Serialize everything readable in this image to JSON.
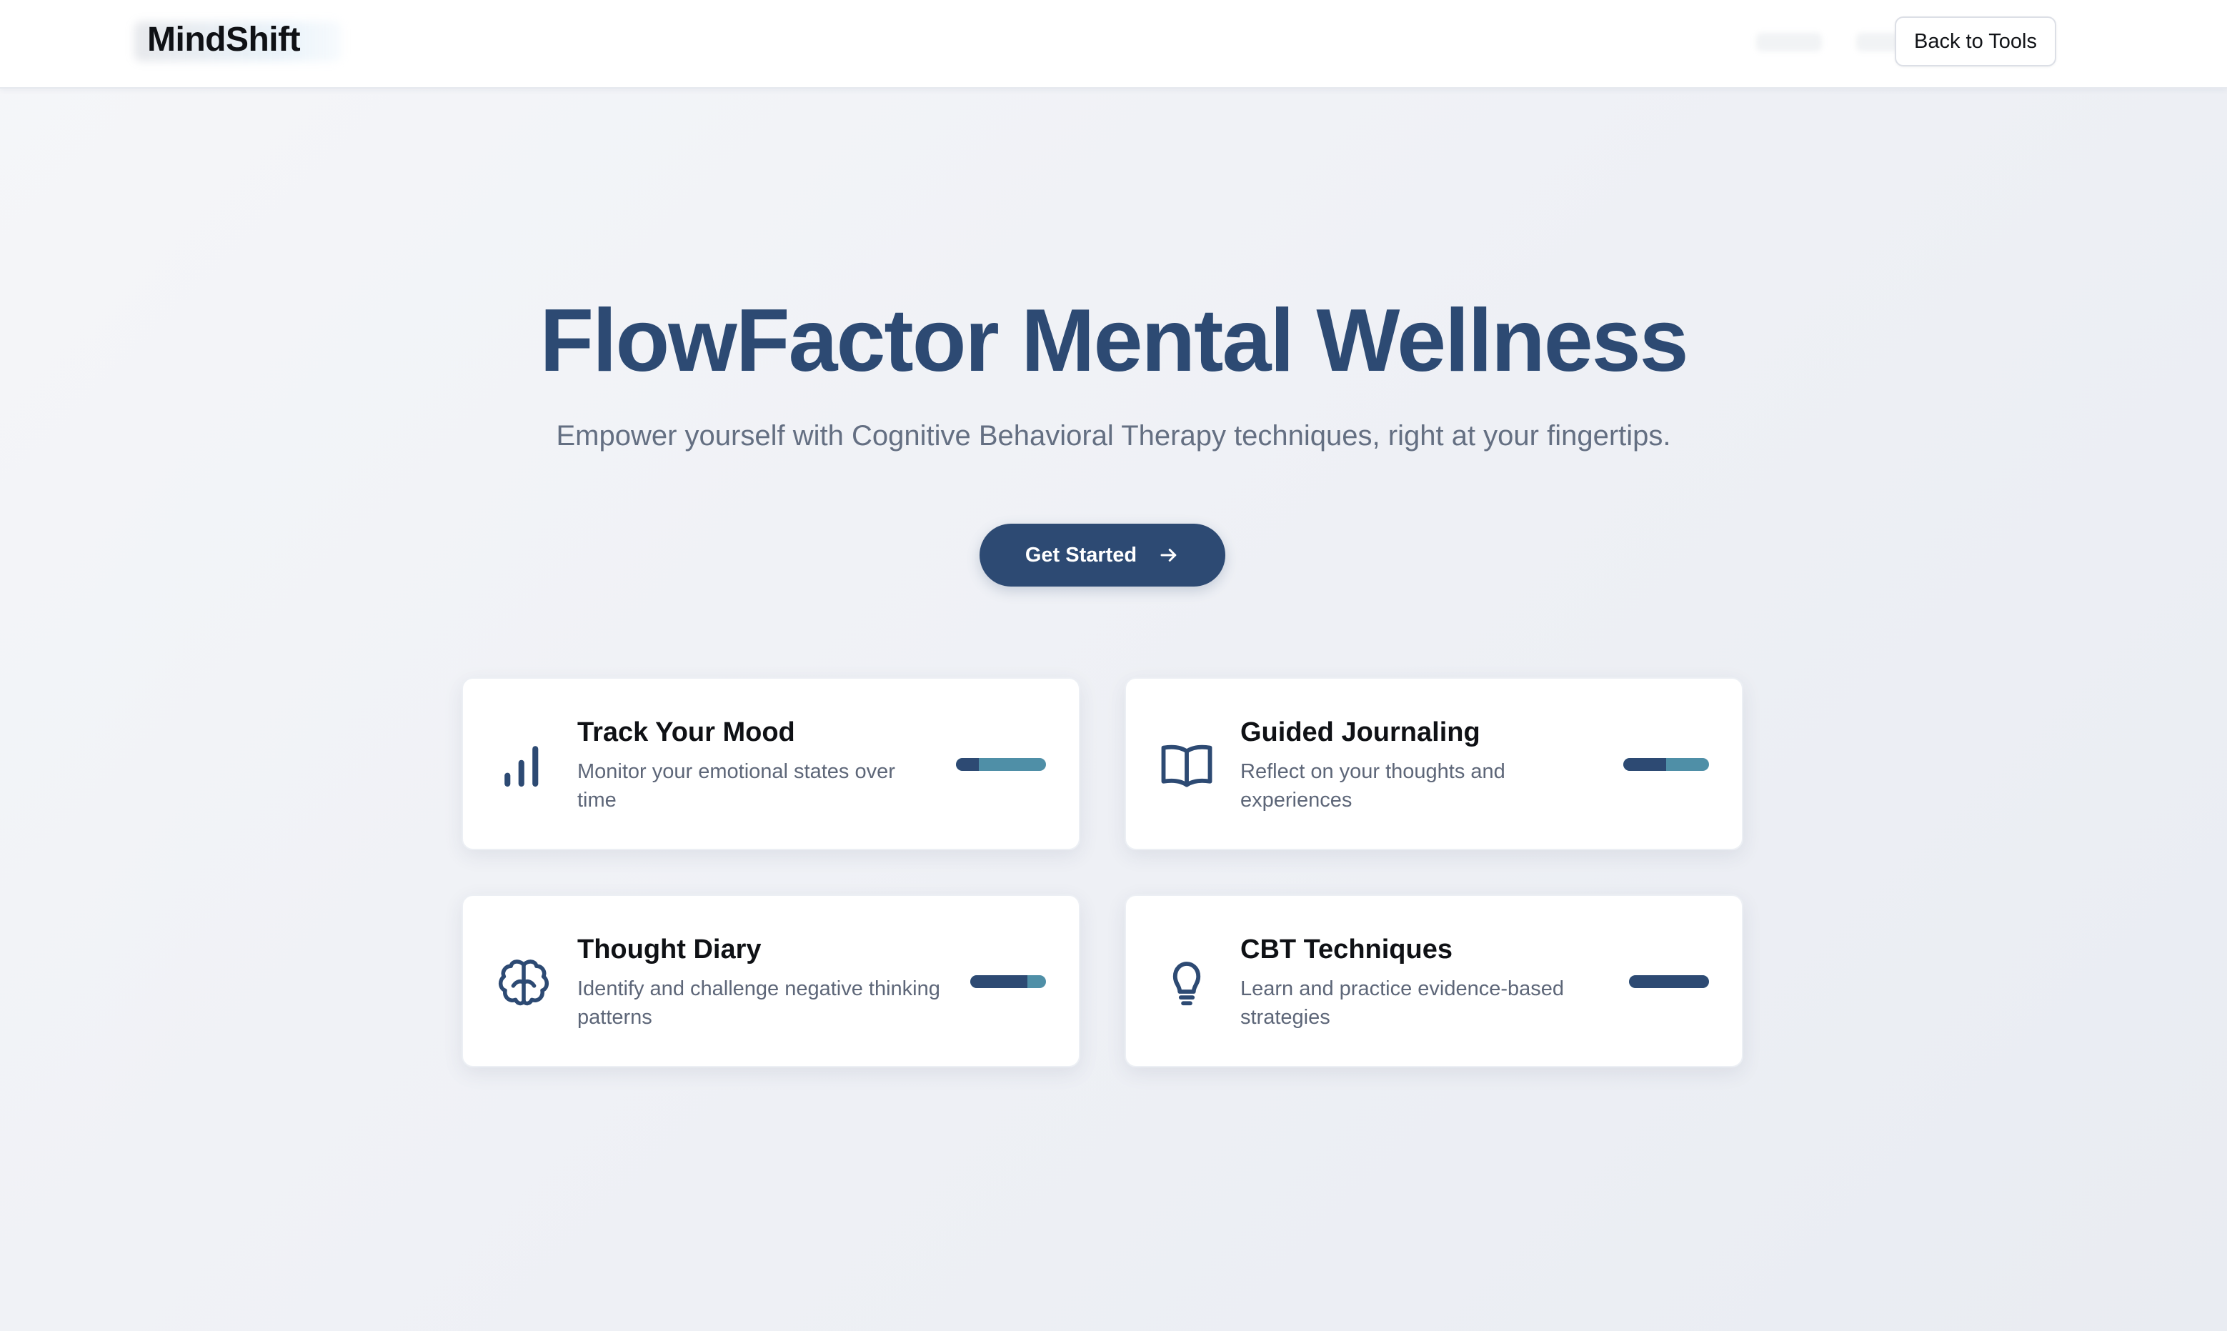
{
  "header": {
    "brand": "MindShift",
    "back_button_label": "Back to Tools"
  },
  "hero": {
    "title": "FlowFactor Mental Wellness",
    "subtitle": "Empower yourself with Cognitive Behavioral Therapy techniques, right at your fingertips.",
    "cta_label": "Get Started",
    "cta_icon": "arrow-right-icon"
  },
  "features": [
    {
      "title": "Track Your Mood",
      "description_lines": [
        "Monitor your emotional states over",
        "time"
      ],
      "icon": "bar-chart-icon",
      "progress": 0.25
    },
    {
      "title": "Guided Journaling",
      "description_lines": [
        "Reflect on your thoughts and",
        "experiences"
      ],
      "icon": "book-open-icon",
      "progress": 0.5
    },
    {
      "title": "Thought Diary",
      "description_lines": [
        "Identify and challenge negative thinking",
        "patterns"
      ],
      "icon": "brain-icon",
      "progress": 0.75
    },
    {
      "title": "CBT Techniques",
      "description_lines": [
        "Learn and practice evidence-based",
        "strategies"
      ],
      "icon": "lightbulb-icon",
      "progress": 1.0
    }
  ],
  "colors": {
    "primary": "#2d4a73",
    "accent": "#4f8fa7",
    "text_dark": "#0f1115",
    "text_muted": "#646f82"
  }
}
